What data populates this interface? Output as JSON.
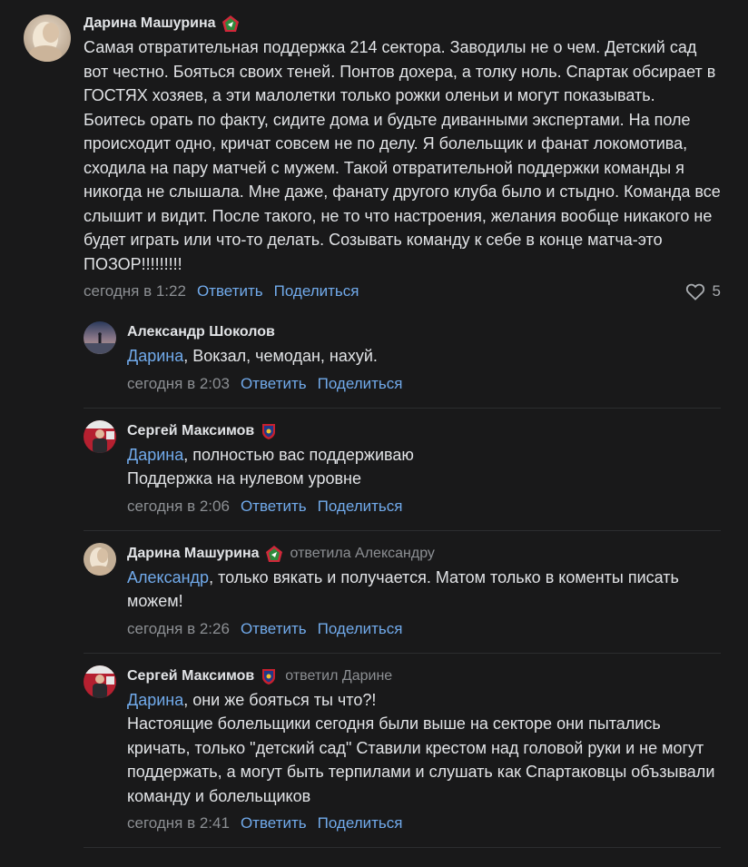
{
  "colors": {
    "background": "#19191a",
    "text": "#e1e3e6",
    "secondary": "#8c8f93",
    "link": "#71aaeb"
  },
  "comments": [
    {
      "author": "Дарина Машурина",
      "badge": "lokomotiv-badge-icon",
      "text": "Самая отвратительная поддержка 214 сектора. Заводилы не о чем. Детский сад вот честно. Бояться своих теней. Понтов дохера, а толку ноль. Спартак обсирает в ГОСТЯХ хозяев, а эти малолетки только рожки оленьи и могут показывать. Боитесь орать по факту, сидите дома и будьте диванными экспертами. На поле происходит одно, кричат совсем не по делу. Я болельщик и фанат локомотива, сходила на пару матчей с мужем. Такой отвратительной поддержки команды я никогда не слышала. Мне даже, фанату другого клуба было и стыдно. Команда все слышит и видит. После такого, не то что настроения, желания вообще никакого не будет играть или что-то делать. Созывать команду к себе в конце матча-это ПОЗОР!!!!!!!!!",
      "time": "сегодня в 1:22",
      "reply_label": "Ответить",
      "share_label": "Поделиться",
      "likes": "5"
    }
  ],
  "replies": [
    {
      "author": "Александр Шоколов",
      "mention": "Дарина",
      "text": ", Вокзал, чемодан, нахуй.",
      "time": "сегодня в 2:03",
      "reply_label": "Ответить",
      "share_label": "Поделиться"
    },
    {
      "author": "Сергей Максимов",
      "badge": "cska-badge-icon",
      "mention": "Дарина",
      "text": ", полностью вас поддерживаю\nПоддержка на нулевом уровне",
      "time": "сегодня в 2:06",
      "reply_label": "Ответить",
      "share_label": "Поделиться"
    },
    {
      "author": "Дарина Машурина",
      "badge": "lokomotiv-badge-icon",
      "reply_to": "ответила Александру",
      "mention": "Александр",
      "text": ", только вякать и получается. Матом только в коменты писать можем!",
      "time": "сегодня в 2:26",
      "reply_label": "Ответить",
      "share_label": "Поделиться"
    },
    {
      "author": "Сергей Максимов",
      "badge": "cska-badge-icon",
      "reply_to": "ответил Дарине",
      "mention": "Дарина",
      "text": ", они же бояться ты что?!\nНастоящие болельщики сегодня были выше на секторе они пытались кричать, только \"детский сад\" Ставили крестом над головой руки и не могут поддержать, а могут быть терпилами и слушать как Спартаковцы объзывали команду и болельщиков",
      "time": "сегодня в 2:41",
      "reply_label": "Ответить",
      "share_label": "Поделиться"
    }
  ]
}
